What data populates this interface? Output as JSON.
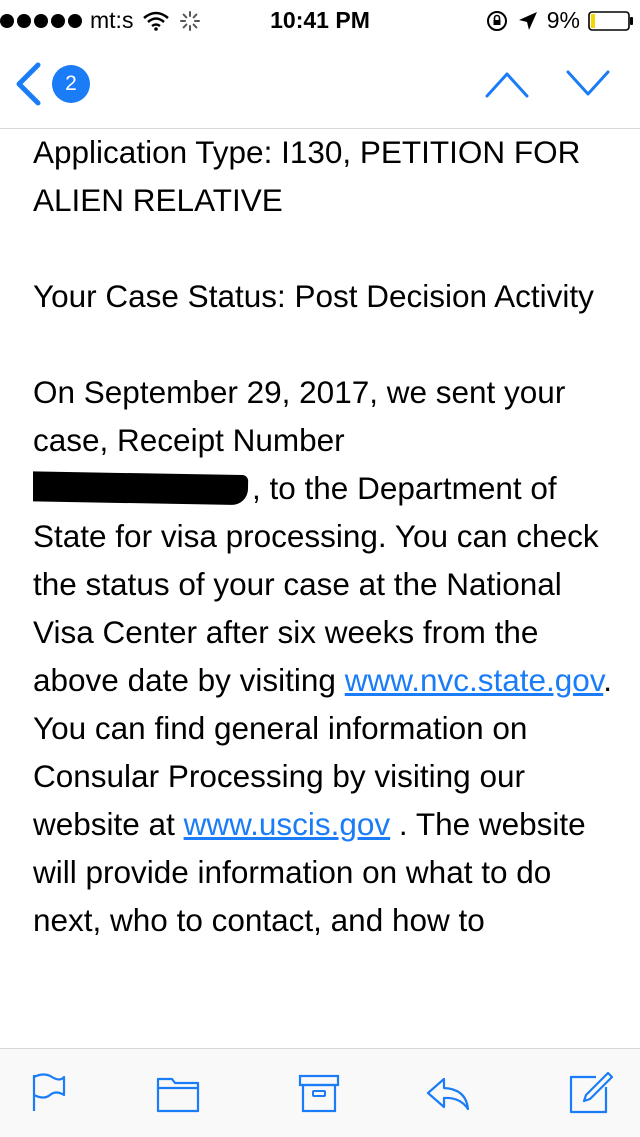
{
  "status_bar": {
    "carrier": "mt:s",
    "time": "10:41 PM",
    "battery": "9%",
    "signal_bars": 5
  },
  "nav": {
    "unread_count": "2",
    "icons": [
      "back-chevron-icon",
      "up-chevron-icon",
      "down-chevron-icon"
    ]
  },
  "email": {
    "p1": "Application Type: I130, PETITION FOR ALIEN RELATIVE",
    "p2": "Your Case Status: Post Decision Activity",
    "p3_a": "On September 29, 2017, we sent your case, Receipt Number",
    "p3_b": ", to the Department of State for visa processing. You can check the status of your case at the National Visa Center after six weeks from the above date by visiting ",
    "link1": "www.nvc.state.gov",
    "p3_c": ". You can find general information on Consular Processing by visiting our website at ",
    "link2": "www.uscis.gov",
    "p3_d": " . The website will provide information on what to do next, who to contact, and how to"
  },
  "toolbar": {
    "icons": [
      "flag-icon",
      "folder-icon",
      "archive-icon",
      "reply-icon",
      "compose-icon"
    ]
  },
  "colors": {
    "accent": "#1a7cf6",
    "divider": "#d8d8d8",
    "toolbar_bg": "#f9f9f9"
  }
}
